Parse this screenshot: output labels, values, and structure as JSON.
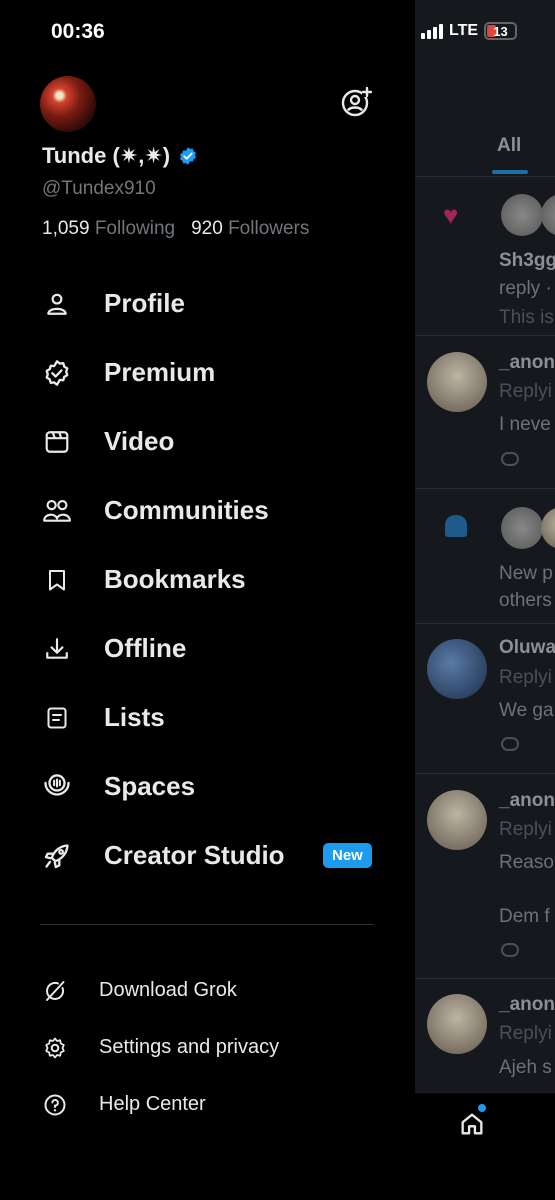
{
  "status": {
    "time": "00:36",
    "network": "LTE",
    "battery": "13"
  },
  "profile": {
    "display_name": "Tunde (✷,✷)",
    "handle": "@Tundex910",
    "following_count": "1,059",
    "following_label": "Following",
    "followers_count": "920",
    "followers_label": "Followers"
  },
  "menu": [
    {
      "label": "Profile",
      "icon": "person-icon"
    },
    {
      "label": "Premium",
      "icon": "premium-badge-icon"
    },
    {
      "label": "Video",
      "icon": "video-icon"
    },
    {
      "label": "Communities",
      "icon": "communities-icon"
    },
    {
      "label": "Bookmarks",
      "icon": "bookmark-icon"
    },
    {
      "label": "Offline",
      "icon": "download-icon"
    },
    {
      "label": "Lists",
      "icon": "list-icon"
    },
    {
      "label": "Spaces",
      "icon": "spaces-icon"
    },
    {
      "label": "Creator Studio",
      "icon": "rocket-icon",
      "badge": "New"
    }
  ],
  "sub_menu": [
    {
      "label": "Download Grok",
      "icon": "grok-icon"
    },
    {
      "label": "Settings and privacy",
      "icon": "gear-icon"
    },
    {
      "label": "Help Center",
      "icon": "help-icon"
    }
  ],
  "feed": {
    "tab": "All",
    "snippets": [
      "Sh3gg",
      "reply ·",
      "This is",
      "_anon",
      "Replyi",
      "I neve",
      "New p",
      "others",
      "Oluwa",
      "Replyi",
      "We ga",
      "_anon",
      "Replyi",
      "Reaso",
      "Dem f",
      "_anon",
      "Replyi",
      "Ajeh s"
    ]
  },
  "colors": {
    "accent": "#1d9bf0",
    "background": "#000000",
    "muted": "#71767b"
  }
}
